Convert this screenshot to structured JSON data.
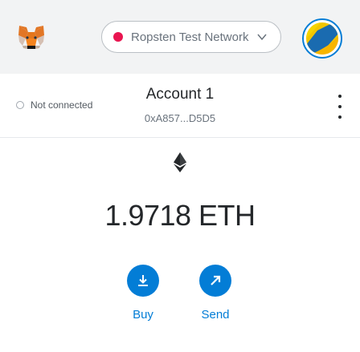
{
  "header": {
    "logo_icon": "metamask-fox-icon",
    "network": {
      "label": "Ropsten Test Network",
      "dot_color": "#e91550"
    },
    "avatar_icon": "account-identicon"
  },
  "account": {
    "connection_status": "Not connected",
    "name": "Account 1",
    "address": "0xA857...D5D5",
    "menu_icon": "kebab-menu-icon"
  },
  "balance": {
    "icon": "ethereum-icon",
    "amount": "1.9718 ETH"
  },
  "actions": [
    {
      "label": "Buy",
      "icon": "download-icon"
    },
    {
      "label": "Send",
      "icon": "send-arrow-icon"
    }
  ],
  "colors": {
    "accent": "#037dd6",
    "header_bg": "#f2f3f4",
    "network_dot": "#e91550"
  }
}
